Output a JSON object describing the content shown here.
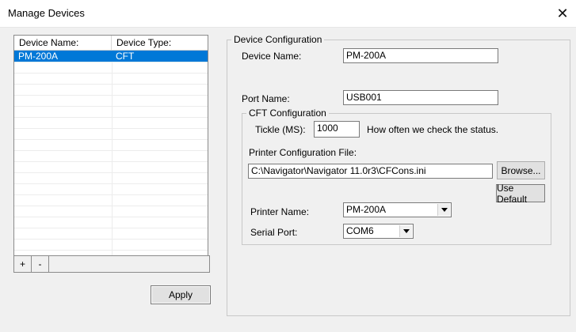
{
  "window": {
    "title": "Manage Devices"
  },
  "device_list": {
    "columns": [
      "Device Name:",
      "Device Type:"
    ],
    "rows": [
      {
        "name": "PM-200A",
        "type": "CFT",
        "selected": true
      }
    ],
    "toolbar": {
      "add_label": "+",
      "remove_label": "-"
    }
  },
  "apply_label": "Apply",
  "device_config": {
    "legend": "Device Configuration",
    "device_name_label": "Device Name:",
    "device_name_value": "PM-200A",
    "port_name_label": "Port Name:",
    "port_name_value": "USB001",
    "cft": {
      "legend": "CFT Configuration",
      "tickle_label": "Tickle (MS):",
      "tickle_value": "1000",
      "tickle_hint": "How often we check the status.",
      "printer_config_label": "Printer Configuration File:",
      "printer_config_value": "C:\\Navigator\\Navigator 11.0r3\\CFCons.ini",
      "browse_label": "Browse...",
      "use_default_label": "Use Default",
      "printer_name_label": "Printer Name:",
      "printer_name_value": "PM-200A",
      "serial_port_label": "Serial Port:",
      "serial_port_value": "COM6"
    }
  },
  "colors": {
    "selection": "#0078d7",
    "window_bg": "#f0f0f0"
  }
}
